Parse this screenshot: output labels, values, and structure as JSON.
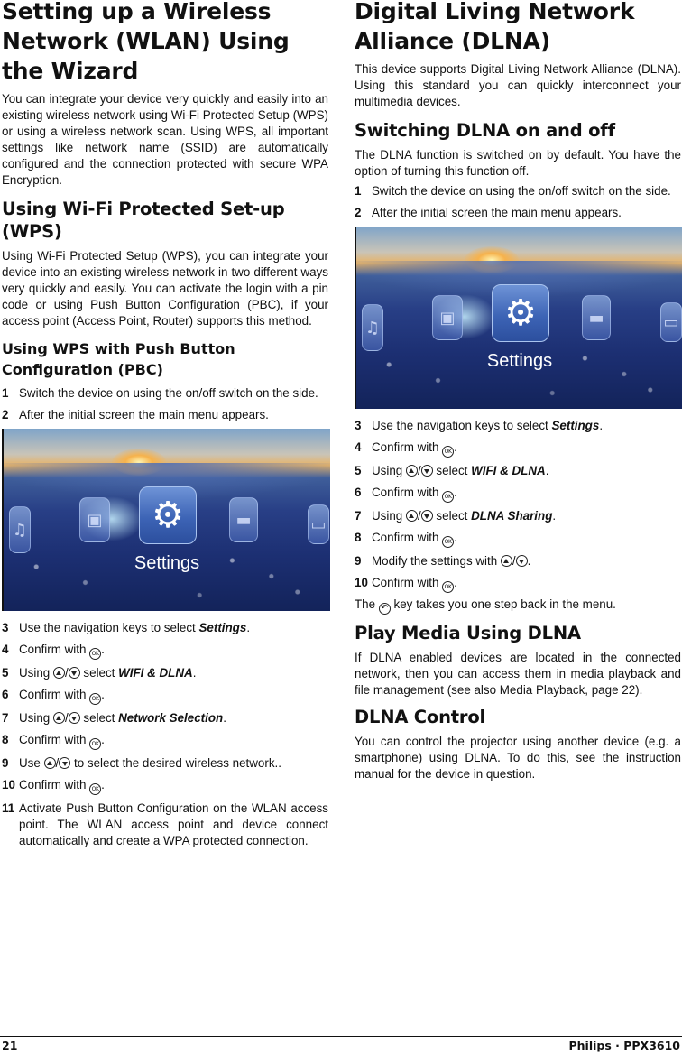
{
  "left": {
    "title": "Setting up a Wireless Network (WLAN) Using the Wizard",
    "intro": "You can integrate your device very quickly and easily into an existing wireless network using Wi-Fi Protected Setup (WPS) or using a wireless network scan. Using WPS, all important settings like network name (SSID) are automatically configured and the connection pro­tected with secure WPA Encryption.",
    "wps_heading": "Using Wi-Fi Protected Set-up (WPS)",
    "wps_text": "Using Wi-Fi Protected Setup (WPS), you can integrate your device into an existing wireless network in two dif­ferent ways very quickly and easily. You can activate the login with a pin code or using Push Button Configura­tion (PBC), if your access point (Access Point, Router) supports this method.",
    "pbc_heading": "Using WPS with Push Button Configuration (PBC)",
    "steps_a": [
      {
        "num": "1",
        "text": "Switch the device on using the on/off switch on the side."
      },
      {
        "num": "2",
        "text": "After the initial screen the main menu appears."
      }
    ],
    "screenshot": {
      "label": "Settings"
    },
    "steps_b": {
      "s3": {
        "num": "3",
        "pre": "Use the navigation keys to select ",
        "em": "Settings",
        "post": "."
      },
      "s4": {
        "num": "4",
        "pre": "Confirm with ",
        "post": "."
      },
      "s5": {
        "num": "5",
        "pre": "Using ",
        "mid": " select ",
        "em": "WIFI & DLNA",
        "post": "."
      },
      "s6": {
        "num": "6",
        "pre": "Confirm with ",
        "post": "."
      },
      "s7": {
        "num": "7",
        "pre": "Using ",
        "mid": " select ",
        "em": "Network Selection",
        "post": "."
      },
      "s8": {
        "num": "8",
        "pre": "Confirm with ",
        "post": "."
      },
      "s9": {
        "num": "9",
        "pre": "Use ",
        "post": " to select the desired wireless network.."
      },
      "s10": {
        "num": "10",
        "pre": "Confirm with ",
        "post": "."
      },
      "s11": {
        "num": "11",
        "text": "Activate Push Button Configuration on the WLAN access point. The WLAN access point and device connect automatically and create a WPA protected connection."
      }
    }
  },
  "right": {
    "title": "Digital Living Network Alliance (DLNA)",
    "intro": "This device supports Digital Living Network Alliance (DLNA). Using this standard you can quickly intercon­nect your multimedia devices.",
    "switch_heading": "Switching DLNA on and off",
    "switch_text": "The DLNA function is switched on by default. You have the option of turning this function off.",
    "steps_a": [
      {
        "num": "1",
        "text": "Switch the device on using the on/off switch on the side."
      },
      {
        "num": "2",
        "text": "After the initial screen the main menu appears."
      }
    ],
    "screenshot": {
      "label": "Settings"
    },
    "steps_b": {
      "s3": {
        "num": "3",
        "pre": "Use the navigation keys to select ",
        "em": "Settings",
        "post": "."
      },
      "s4": {
        "num": "4",
        "pre": "Confirm with ",
        "post": "."
      },
      "s5": {
        "num": "5",
        "pre": "Using ",
        "mid": " select ",
        "em": "WIFI & DLNA",
        "post": "."
      },
      "s6": {
        "num": "6",
        "pre": "Confirm with ",
        "post": "."
      },
      "s7": {
        "num": "7",
        "pre": "Using ",
        "mid": " select ",
        "em": "DLNA Sharing",
        "post": "."
      },
      "s8": {
        "num": "8",
        "pre": "Confirm with ",
        "post": "."
      },
      "s9": {
        "num": "9",
        "pre": "Modify the settings with ",
        "post": "."
      },
      "s10": {
        "num": "10",
        "pre": "Confirm with ",
        "post": "."
      }
    },
    "back_note": {
      "pre": "The ",
      "post": " key takes you one step back in the menu."
    },
    "play_heading": "Play Media Using DLNA",
    "play_text": "If DLNA enabled devices are located in the connected network, then you can access them in media playback and file management (see also Media Playback, page 22).",
    "control_heading": "DLNA Control",
    "control_text": "You can control the projector using another device (e.g. a smartphone) using DLNA. To do this, see the instruc­tion manual for the device in question."
  },
  "keys": {
    "ok": "OK",
    "back": "↶"
  },
  "footer": {
    "page_number": "21",
    "brand": "Philips · PPX3610"
  }
}
